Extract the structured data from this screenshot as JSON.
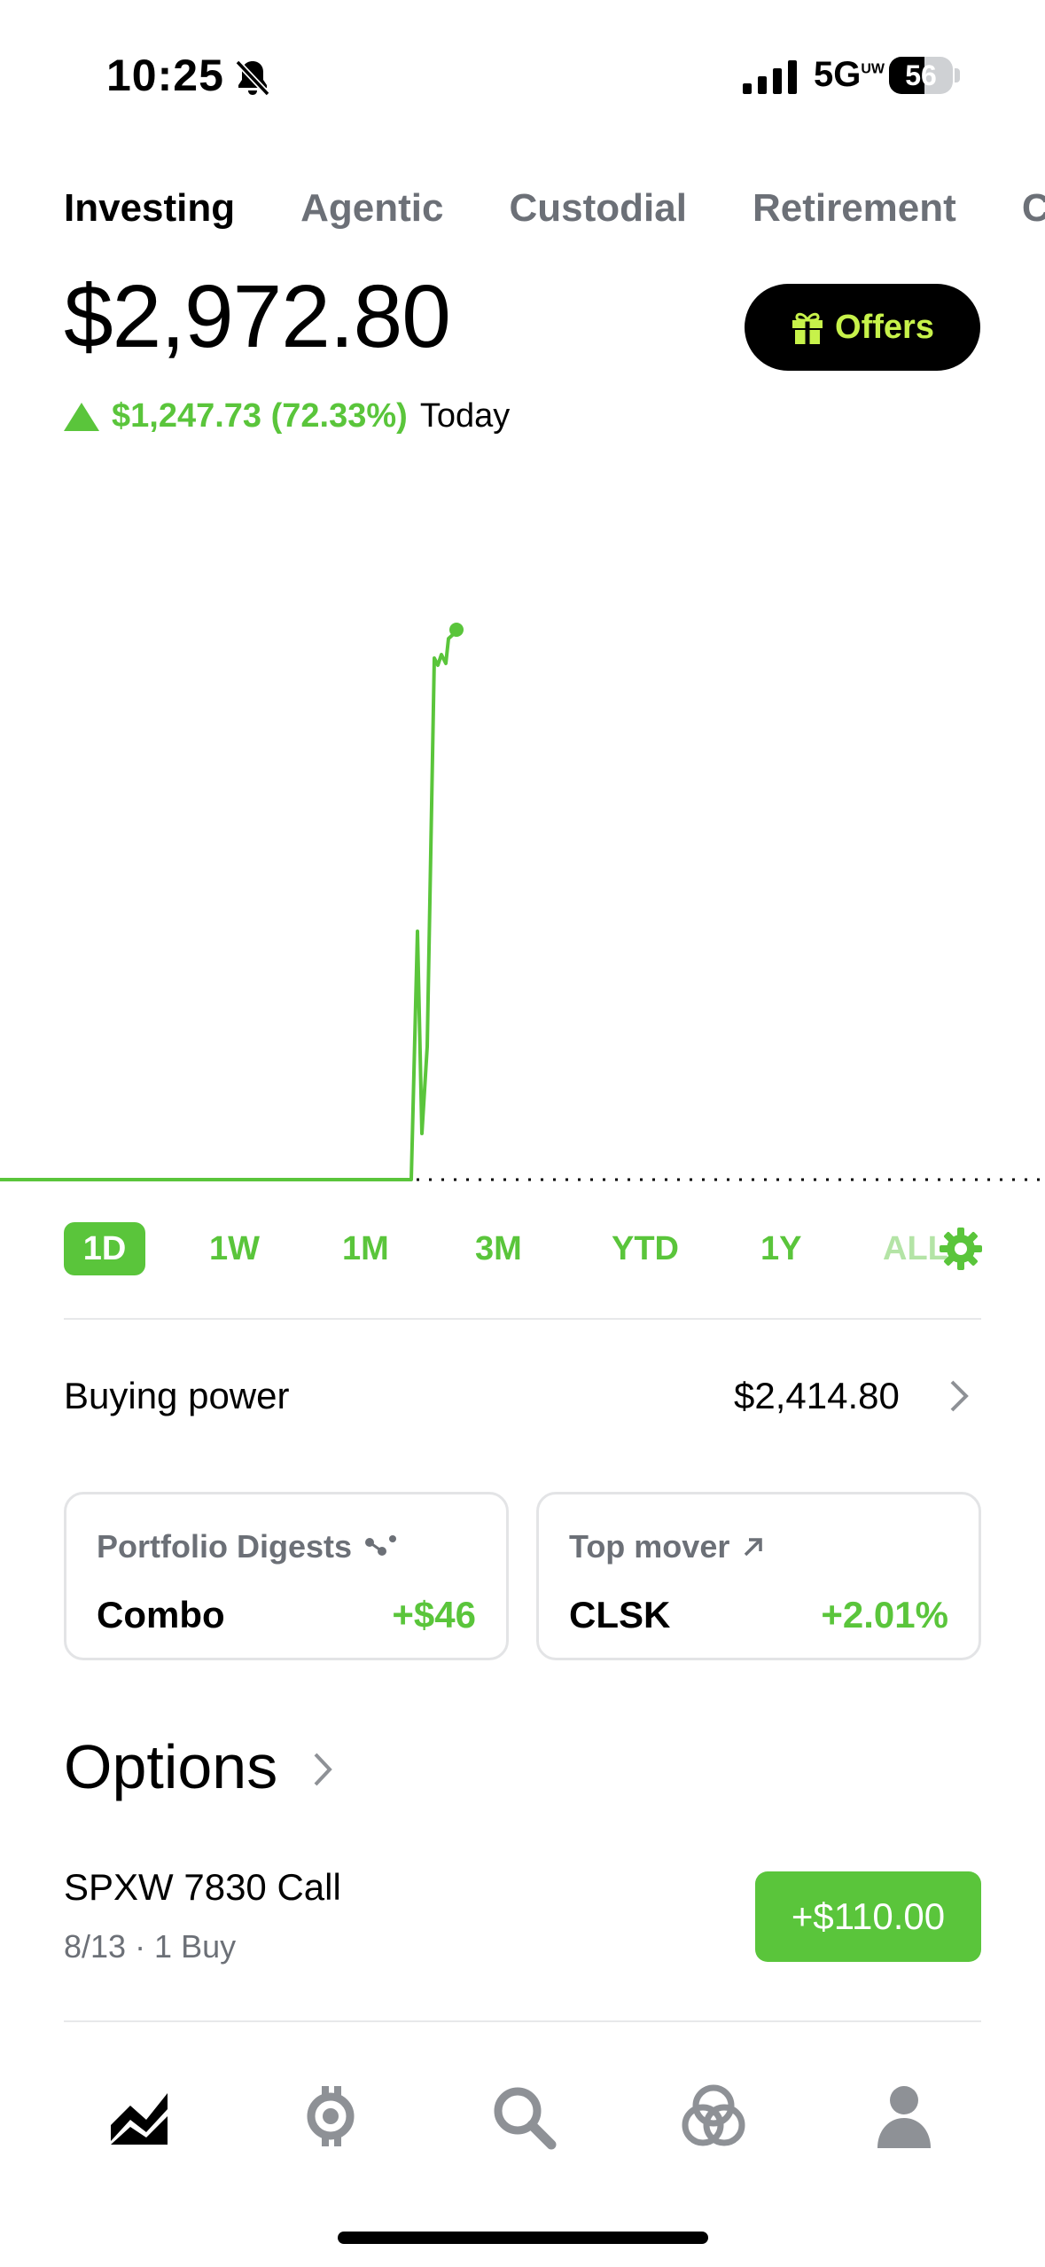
{
  "status_bar": {
    "time": "10:25",
    "network": "5G",
    "network_sup": "UW",
    "battery": "56",
    "battery_level": 0.56
  },
  "tabs": [
    "Investing",
    "Agentic",
    "Custodial",
    "Retirement",
    "Cr"
  ],
  "portfolio": {
    "value": "$2,972.80",
    "change": "$1,247.73 (72.33%)",
    "period": "Today"
  },
  "offers_label": "Offers",
  "ranges": [
    "1D",
    "1W",
    "1M",
    "3M",
    "YTD",
    "1Y",
    "ALL"
  ],
  "buying_power": {
    "label": "Buying power",
    "value": "$2,414.80"
  },
  "cards": [
    {
      "title": "Portfolio Digests",
      "name": "Combo",
      "value": "+$46"
    },
    {
      "title": "Top mover",
      "name": "CLSK",
      "value": "+2.01%"
    }
  ],
  "options": {
    "title": "Options",
    "item": {
      "name": "SPXW 7830 Call",
      "sub": "8/13 · 1 Buy",
      "value": "+$110.00"
    }
  },
  "colors": {
    "accent": "#5ac53b",
    "offers_text": "#c7f24a",
    "muted": "#6c7077"
  },
  "nav": [
    "investing-chart-icon",
    "crypto-icon",
    "search-icon",
    "network-icon",
    "account-icon"
  ]
}
